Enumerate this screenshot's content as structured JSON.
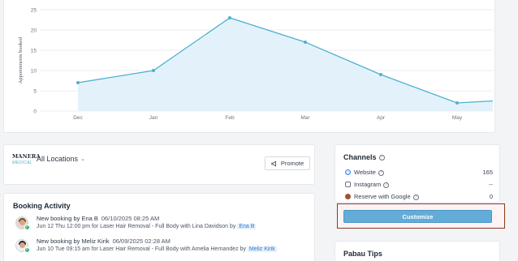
{
  "chart_data": {
    "type": "area",
    "ylabel": "Appointments booked",
    "ylim": [
      0,
      25
    ],
    "yticks": [
      "0",
      "5",
      "10",
      "15",
      "20",
      "25"
    ],
    "categories": [
      "Dec",
      "Jan",
      "Feb",
      "Mar",
      "Apr",
      "May"
    ],
    "series": [
      {
        "values": [
          7,
          10,
          23,
          17,
          9,
          2,
          2.5
        ]
      }
    ],
    "grid": true,
    "colors": {
      "line": "#4fb0d0",
      "fill": "#e3f2fa"
    }
  },
  "location": {
    "logo_line1": "MANERA",
    "logo_line2": "MEDICAL",
    "label": "All Locations",
    "chevron": "⌄",
    "promote_label": "Promote"
  },
  "activity": {
    "title": "Booking Activity",
    "items": [
      {
        "headline": "New booking by Ena B",
        "time": "06/10/2025 08:25 AM",
        "detail": "Jun 12 Thu 12:00 pm for Laser Hair Removal - Full Body with Lina Davidson by",
        "staff": "Ena B"
      },
      {
        "headline": "New booking by Meliz Kirik",
        "time": "06/09/2025 02:28 AM",
        "detail": "Jun 10 Tue 09:15 am for Laser Hair Removal - Full Body with Amelia Hernandez by",
        "staff": "Meliz Kirik"
      }
    ]
  },
  "channels": {
    "title": "Channels",
    "rows": [
      {
        "name": "Website",
        "value": "165",
        "icon": "globe-icon"
      },
      {
        "name": "Instagram",
        "value": "--",
        "icon": "instagram-icon"
      },
      {
        "name": "Reserve with Google",
        "value": "0",
        "icon": "google-icon"
      }
    ],
    "customize_label": "Customize"
  },
  "tips": {
    "title": "Pabau Tips"
  }
}
